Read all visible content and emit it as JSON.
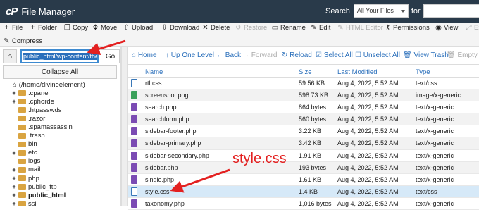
{
  "app": {
    "logo": "cP",
    "title": "File Manager"
  },
  "search": {
    "label": "Search",
    "scope": "All Your Files",
    "for_label": "for",
    "value": ""
  },
  "toolbar": {
    "row1": [
      {
        "label": "File",
        "icon": "plus-icon",
        "enabled": true
      },
      {
        "label": "Folder",
        "icon": "plus-icon",
        "enabled": true
      },
      {
        "label": "Copy",
        "icon": "copy-icon",
        "enabled": true
      },
      {
        "label": "Move",
        "icon": "move-icon",
        "enabled": true
      },
      {
        "label": "Upload",
        "icon": "upload-icon",
        "enabled": true
      },
      {
        "label": "Download",
        "icon": "download-icon",
        "enabled": true
      },
      {
        "label": "Delete",
        "icon": "close-icon",
        "enabled": true
      },
      {
        "label": "Restore",
        "icon": "restore-icon",
        "enabled": false
      },
      {
        "label": "Rename",
        "icon": "rename-icon",
        "enabled": true
      },
      {
        "label": "Edit",
        "icon": "pencil-icon",
        "enabled": true
      },
      {
        "label": "HTML Editor",
        "icon": "html-editor-icon",
        "enabled": false
      },
      {
        "label": "Permissions",
        "icon": "key-icon",
        "enabled": true
      },
      {
        "label": "View",
        "icon": "eye-icon",
        "enabled": true
      },
      {
        "label": "Ext",
        "icon": "extract-icon",
        "enabled": false
      }
    ],
    "compress": "Compress"
  },
  "left": {
    "path_value": "public_html/wp-content/the",
    "go": "Go",
    "collapse": "Collapse All",
    "tree": [
      {
        "label": "(/home/divineelement)",
        "pm": "–",
        "depth": 0,
        "home": true,
        "bold": false
      },
      {
        "label": ".cpanel",
        "pm": "+",
        "depth": 1,
        "bold": false
      },
      {
        "label": ".cphorde",
        "pm": "+",
        "depth": 1,
        "bold": false
      },
      {
        "label": ".htpasswds",
        "pm": "",
        "depth": 1,
        "bold": false
      },
      {
        "label": ".razor",
        "pm": "",
        "depth": 1,
        "bold": false
      },
      {
        "label": ".spamassassin",
        "pm": "",
        "depth": 1,
        "bold": false
      },
      {
        "label": ".trash",
        "pm": "",
        "depth": 1,
        "bold": false
      },
      {
        "label": "bin",
        "pm": "",
        "depth": 1,
        "bold": false
      },
      {
        "label": "etc",
        "pm": "+",
        "depth": 1,
        "bold": false
      },
      {
        "label": "logs",
        "pm": "",
        "depth": 1,
        "bold": false
      },
      {
        "label": "mail",
        "pm": "+",
        "depth": 1,
        "bold": false
      },
      {
        "label": "php",
        "pm": "+",
        "depth": 1,
        "bold": false
      },
      {
        "label": "public_ftp",
        "pm": "+",
        "depth": 1,
        "bold": false
      },
      {
        "label": "public_html",
        "pm": "+",
        "depth": 1,
        "bold": true
      },
      {
        "label": "ssl",
        "pm": "+",
        "depth": 1,
        "bold": false
      }
    ]
  },
  "nav": [
    {
      "label": "Home",
      "icon": "home-icon",
      "enabled": true
    },
    {
      "label": "Up One Level",
      "icon": "up-arrow-icon",
      "enabled": true
    },
    {
      "label": "Back",
      "icon": "back-arrow-icon",
      "enabled": true
    },
    {
      "label": "Forward",
      "icon": "forward-arrow-icon",
      "enabled": false
    },
    {
      "label": "Reload",
      "icon": "reload-icon",
      "enabled": true
    },
    {
      "label": "Select All",
      "icon": "checkbox-checked-icon",
      "enabled": true
    },
    {
      "label": "Unselect All",
      "icon": "checkbox-empty-icon",
      "enabled": true
    },
    {
      "label": "View Trash",
      "icon": "trash-icon",
      "enabled": true
    },
    {
      "label": "Empty Tra",
      "icon": "trash-icon",
      "enabled": false
    }
  ],
  "columns": {
    "name": "Name",
    "size": "Size",
    "modified": "Last Modified",
    "type": "Type"
  },
  "files": [
    {
      "name": "rtl.css",
      "size": "59.56 KB",
      "modified": "Aug 4, 2022, 5:52 AM",
      "type": "text/css",
      "kind": "css"
    },
    {
      "name": "screenshot.png",
      "size": "598.73 KB",
      "modified": "Aug 4, 2022, 5:52 AM",
      "type": "image/x-generic",
      "kind": "img"
    },
    {
      "name": "search.php",
      "size": "864 bytes",
      "modified": "Aug 4, 2022, 5:52 AM",
      "type": "text/x-generic",
      "kind": "php"
    },
    {
      "name": "searchform.php",
      "size": "560 bytes",
      "modified": "Aug 4, 2022, 5:52 AM",
      "type": "text/x-generic",
      "kind": "php"
    },
    {
      "name": "sidebar-footer.php",
      "size": "3.22 KB",
      "modified": "Aug 4, 2022, 5:52 AM",
      "type": "text/x-generic",
      "kind": "php"
    },
    {
      "name": "sidebar-primary.php",
      "size": "3.42 KB",
      "modified": "Aug 4, 2022, 5:52 AM",
      "type": "text/x-generic",
      "kind": "php"
    },
    {
      "name": "sidebar-secondary.php",
      "size": "1.91 KB",
      "modified": "Aug 4, 2022, 5:52 AM",
      "type": "text/x-generic",
      "kind": "php"
    },
    {
      "name": "sidebar.php",
      "size": "193 bytes",
      "modified": "Aug 4, 2022, 5:52 AM",
      "type": "text/x-generic",
      "kind": "php"
    },
    {
      "name": "single.php",
      "size": "1.61 KB",
      "modified": "Aug 4, 2022, 5:52 AM",
      "type": "text/x-generic",
      "kind": "php"
    },
    {
      "name": "style.css",
      "size": "1.4 KB",
      "modified": "Aug 4, 2022, 5:52 AM",
      "type": "text/css",
      "kind": "css",
      "selected": true
    },
    {
      "name": "taxonomy.php",
      "size": "1,016 bytes",
      "modified": "Aug 4, 2022, 5:52 AM",
      "type": "text/x-generic",
      "kind": "php"
    }
  ],
  "annotation": {
    "text": "style.css",
    "color": "#e32020"
  },
  "colors": {
    "topbar": "#293a4a",
    "accent": "#2a6fbb",
    "selected_row": "#d6e9f8",
    "arrow": "#e32020"
  }
}
